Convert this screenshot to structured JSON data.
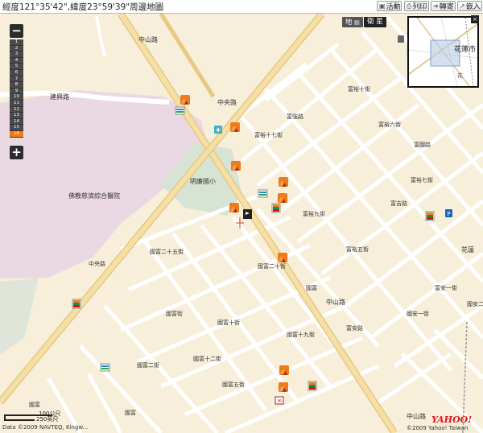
{
  "title": "經度121°35'42\",緯度23°59'39\"周邊地圖",
  "toolbar": [
    {
      "label": "活動",
      "icon": "square-icon"
    },
    {
      "label": "列印",
      "icon": "print-icon"
    },
    {
      "label": "轉寄",
      "icon": "forward-icon"
    },
    {
      "label": "嵌入",
      "icon": "embed-icon"
    }
  ],
  "map_type": {
    "map_label": "地",
    "satellite_label": "衛 星",
    "selected": "map"
  },
  "zoom": {
    "minus": "−",
    "plus": "+",
    "levels": [
      "1",
      "2",
      "3",
      "4",
      "5",
      "6",
      "7",
      "8",
      "9",
      "10",
      "11",
      "12",
      "13",
      "14",
      "15",
      "16"
    ],
    "current": "16"
  },
  "minimap": {
    "city_label": "花蓮市",
    "road_label": "花",
    "close": "×"
  },
  "scale": {
    "upper": "100公尺",
    "lower": "250英尺"
  },
  "attribution": "Data ©2009 NAVTEQ, Kingw...",
  "copyright": "©2009 Yahoo! Taiwan",
  "brand": "YAHOO!",
  "labels": {
    "hospital": "佛教慈濟綜合醫院",
    "school": "明廉國小",
    "hualien_edge": "花蓮",
    "roads": [
      {
        "text": "中山路",
        "kind": "vert"
      },
      {
        "text": "中央路",
        "kind": "vert"
      },
      {
        "text": "建興路",
        "kind": "horiz"
      },
      {
        "text": "富強路",
        "kind": "vert"
      },
      {
        "text": "富裕十七街",
        "kind": "vert"
      },
      {
        "text": "富裕十街",
        "kind": "vert"
      },
      {
        "text": "富裕六街",
        "kind": "vert"
      },
      {
        "text": "富國路",
        "kind": "vert"
      },
      {
        "text": "富裕五街",
        "kind": "vert"
      },
      {
        "text": "富吉路",
        "kind": "horiz"
      },
      {
        "text": "富裕七街",
        "kind": "vert"
      },
      {
        "text": "富裕九街",
        "kind": "vert"
      },
      {
        "text": "國富二十五街",
        "kind": "vert"
      },
      {
        "text": "國富二十街",
        "kind": "vert"
      },
      {
        "text": "國富十九街",
        "kind": "vert"
      },
      {
        "text": "國富十二街",
        "kind": "vert"
      },
      {
        "text": "國富十街",
        "kind": "vert"
      },
      {
        "text": "國富五街",
        "kind": "vert"
      },
      {
        "text": "國富二街",
        "kind": "vert"
      },
      {
        "text": "國富街",
        "kind": "vert"
      },
      {
        "text": "富安路",
        "kind": "vert"
      },
      {
        "text": "國安一街",
        "kind": "vert"
      },
      {
        "text": "富安一街",
        "kind": "vert"
      },
      {
        "text": "國安二街",
        "kind": "vert"
      },
      {
        "text": "國富",
        "kind": "vert"
      },
      {
        "text": "中山路",
        "kind": "vert"
      },
      {
        "text": "富安路",
        "kind": "vert"
      },
      {
        "text": "國富",
        "kind": "vert"
      },
      {
        "text": "國富",
        "kind": "vert"
      }
    ]
  }
}
